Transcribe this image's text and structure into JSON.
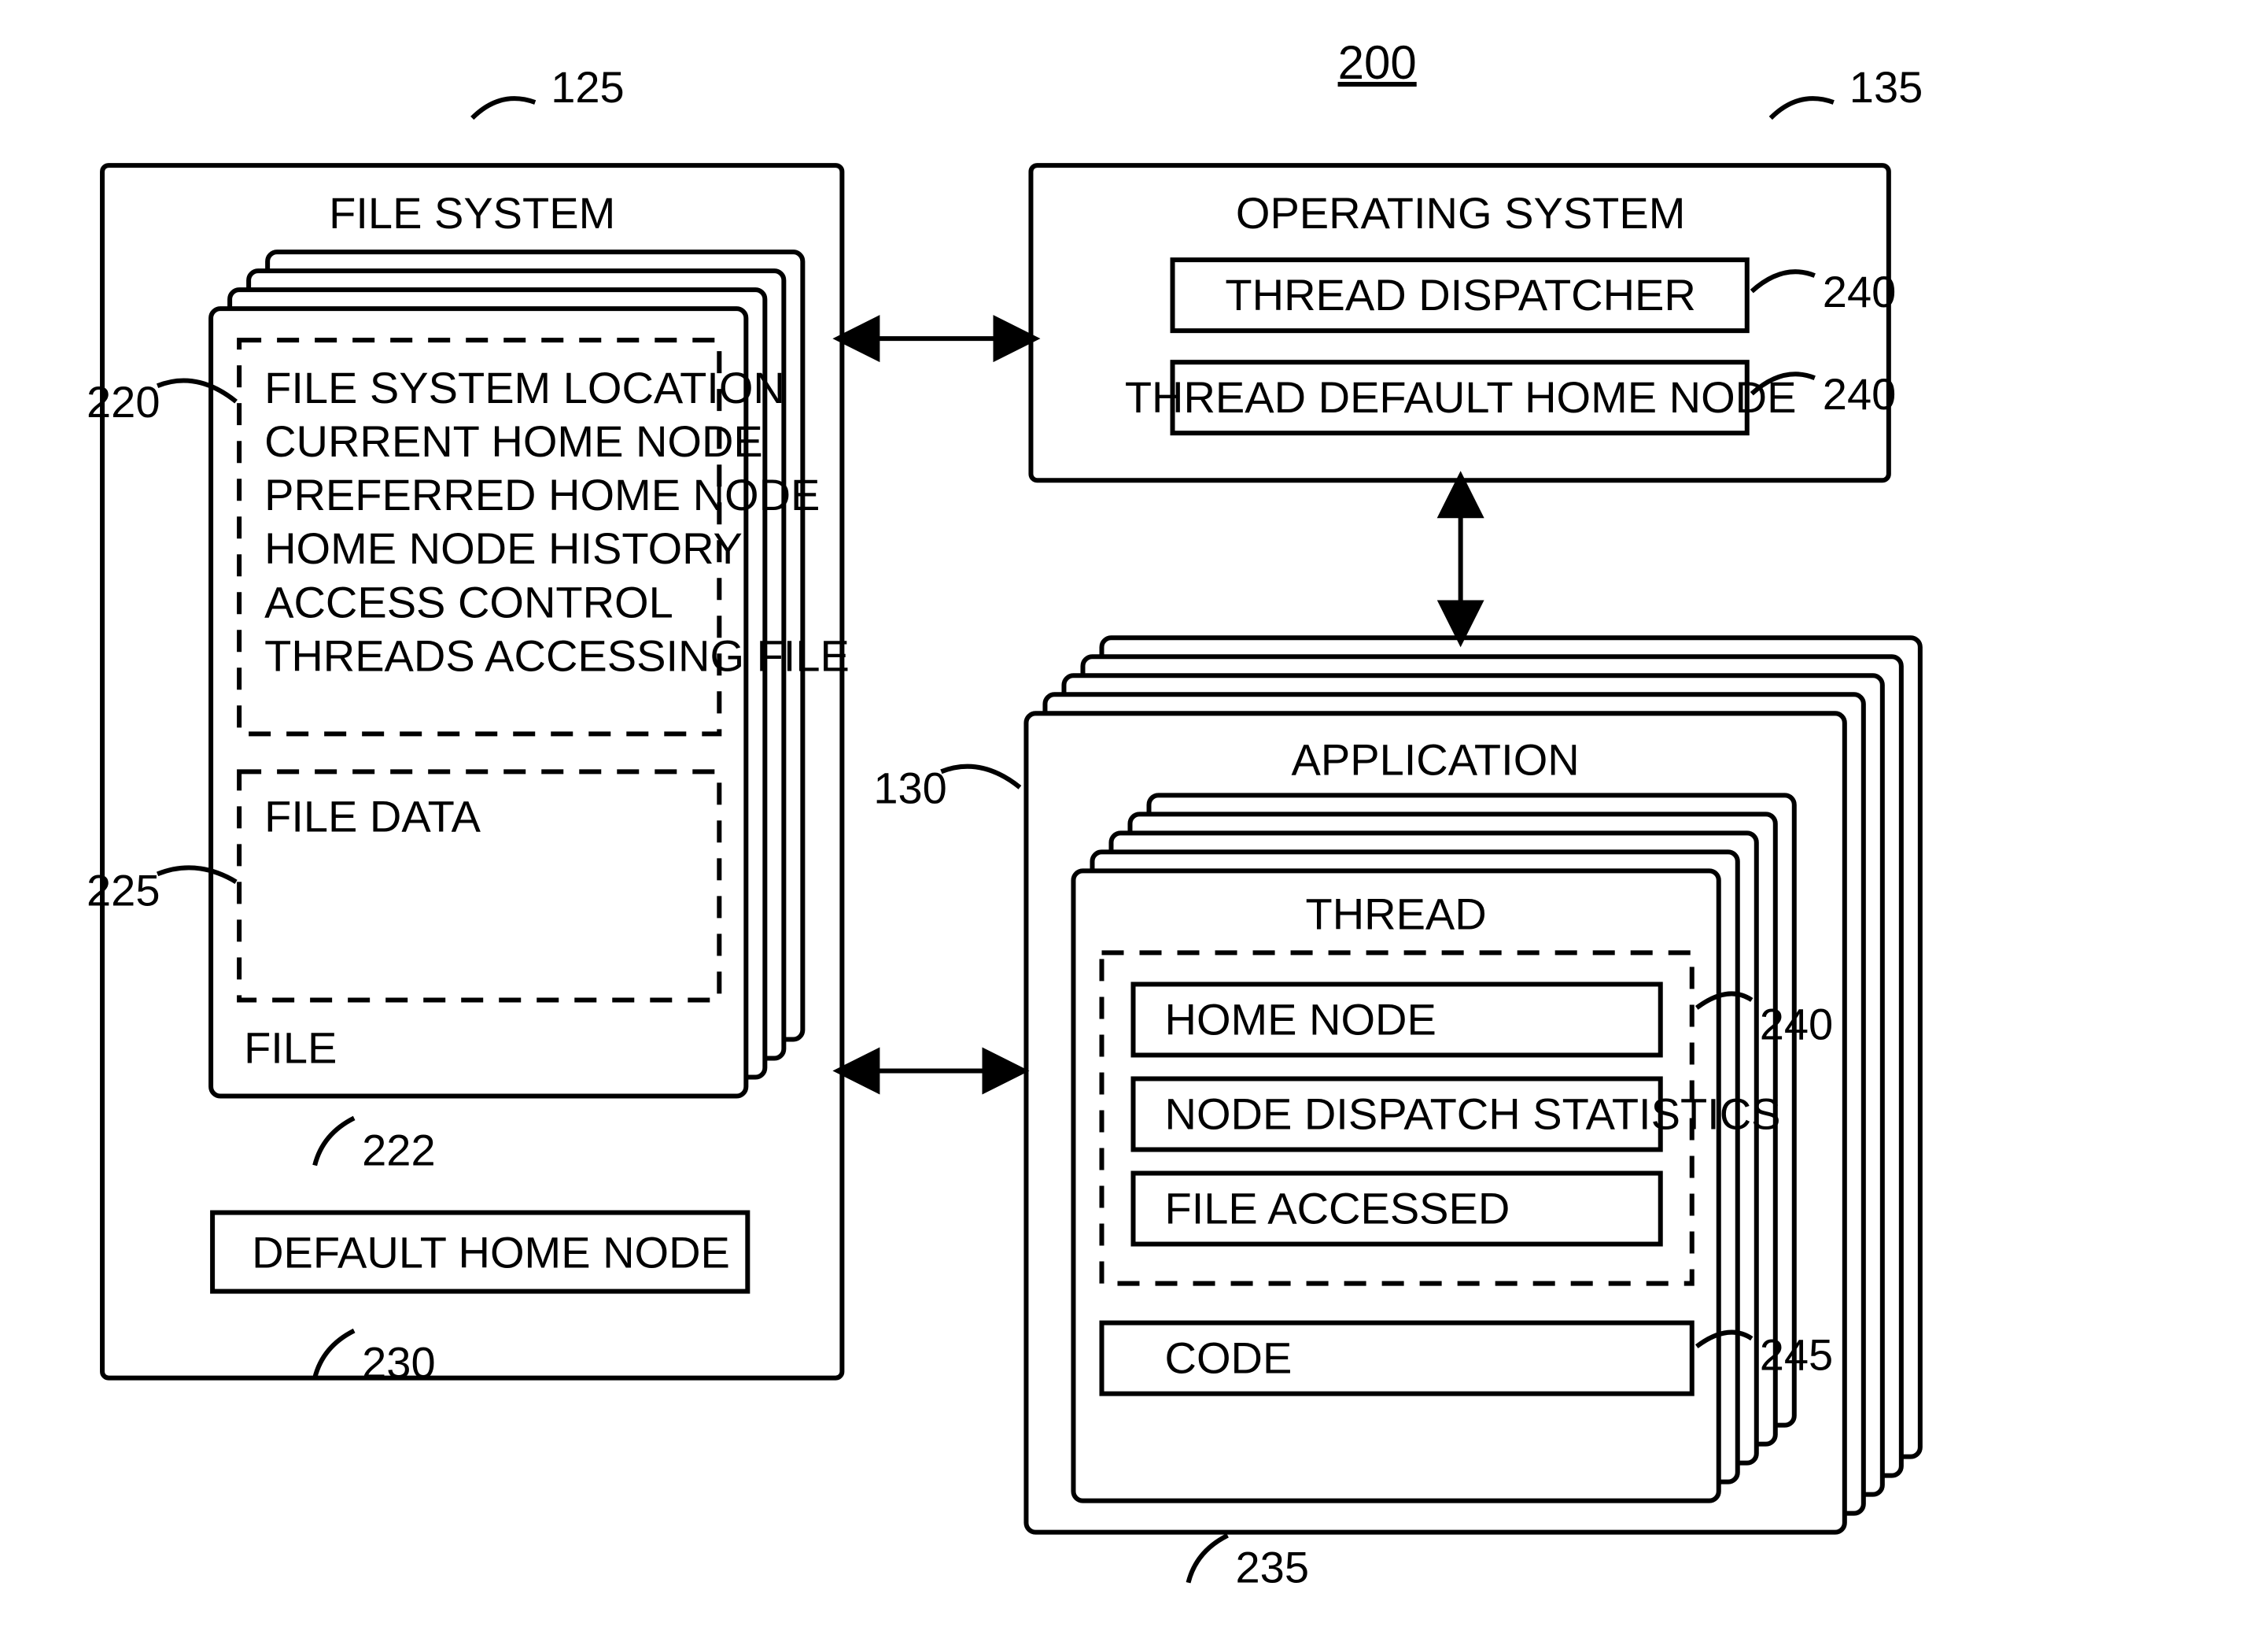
{
  "figure_ref": "200",
  "file_system": {
    "title": "FILE SYSTEM",
    "ref": "125",
    "file": {
      "label": "FILE",
      "ref": "222",
      "metadata_ref": "220",
      "metadata_lines": [
        "FILE SYSTEM LOCATION",
        "CURRENT HOME NODE",
        "PREFERRED HOME NODE",
        "HOME NODE HISTORY",
        "ACCESS CONTROL",
        "THREADS ACCESSING FILE"
      ],
      "data_label": "FILE DATA",
      "data_ref": "225"
    },
    "default_home_node": {
      "label": "DEFAULT HOME NODE",
      "ref": "230"
    }
  },
  "operating_system": {
    "title": "OPERATING SYSTEM",
    "ref": "135",
    "thread_dispatcher": {
      "label": "THREAD DISPATCHER",
      "ref": "240"
    },
    "thread_default_home_node": {
      "label": "THREAD DEFAULT HOME NODE",
      "ref": "240"
    }
  },
  "application": {
    "title": "APPLICATION",
    "ref": "130",
    "thread": {
      "title": "THREAD",
      "ref": "235",
      "dashed_ref": "240",
      "items": [
        "HOME NODE",
        "NODE DISPATCH STATISTICS",
        "FILE ACCESSED"
      ],
      "code": {
        "label": "CODE",
        "ref": "245"
      }
    }
  }
}
